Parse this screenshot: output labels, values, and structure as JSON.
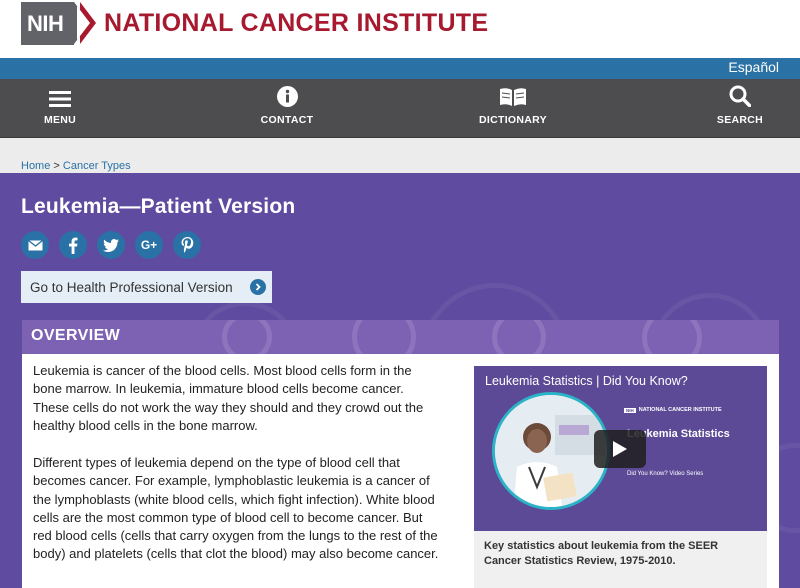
{
  "header": {
    "logo_mark": "NIH",
    "logo_text": "NATIONAL CANCER INSTITUTE",
    "brand_color": "#a6192e"
  },
  "lang": {
    "label": "Español"
  },
  "nav": {
    "items": [
      {
        "label": "MENU",
        "icon": "menu-icon"
      },
      {
        "label": "CONTACT",
        "icon": "info-icon"
      },
      {
        "label": "DICTIONARY",
        "icon": "book-icon"
      },
      {
        "label": "SEARCH",
        "icon": "search-icon"
      }
    ]
  },
  "breadcrumb": {
    "home": "Home",
    "separator": ">",
    "current": "Cancer Types"
  },
  "page": {
    "title": "Leukemia—Patient Version",
    "share": [
      "email-icon",
      "facebook-icon",
      "twitter-icon",
      "google-plus-icon",
      "pinterest-icon"
    ],
    "google_plus_glyph": "G+",
    "pro_link": "Go to Health Professional Version",
    "section_title": "OVERVIEW"
  },
  "content": {
    "para1": "Leukemia is cancer of the blood cells. Most blood cells form in the bone marrow. In leukemia, immature blood cells become cancer. These cells do not work the way they should and they crowd out the healthy blood cells in the bone marrow.",
    "para2": "Different types of leukemia depend on the type of blood cell that becomes cancer. For example, lymphoblastic leukemia is a cancer of the lymphoblasts (white blood cells, which fight infection). White blood cells are the most common type of blood cell to become cancer. But red blood cells (cells that carry oxygen from the lungs to the rest of the body) and platelets (cells that clot the blood) may also become cancer."
  },
  "video": {
    "title": "Leukemia Statistics | Did You Know?",
    "brand_mini": "NIH",
    "brand_text": "NATIONAL CANCER INSTITUTE",
    "slide_title": "Leukemia Statistics",
    "series": "Did You Know? Video Series",
    "caption": "Key statistics about leukemia from the SEER Cancer Statistics Review, 1975-2010."
  },
  "colors": {
    "lang_bar": "#2a72a5",
    "nav_bar": "#4d4d4f",
    "hero": "#5f4b9f",
    "section_head": "#7d62b4"
  }
}
